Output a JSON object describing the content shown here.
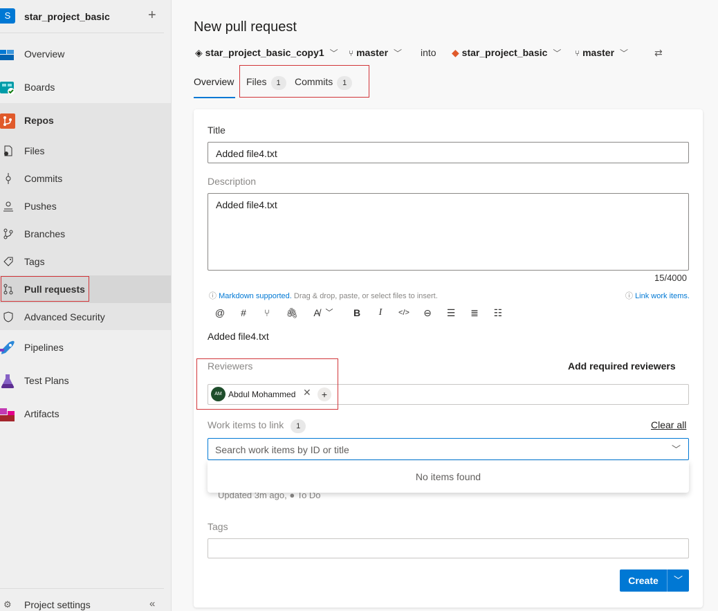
{
  "project": {
    "initial": "S",
    "name": "star_project_basic",
    "add_icon": "plus-icon"
  },
  "nav": {
    "overview": "Overview",
    "boards": "Boards",
    "repos": "Repos",
    "files": "Files",
    "commits": "Commits",
    "pushes": "Pushes",
    "branches": "Branches",
    "tags": "Tags",
    "pull_requests": "Pull requests",
    "advanced_security": "Advanced Security",
    "pipelines": "Pipelines",
    "test_plans": "Test Plans",
    "artifacts": "Artifacts",
    "project_settings": "Project settings",
    "collapse_glyph": "«"
  },
  "page": {
    "title": "New pull request"
  },
  "branches": {
    "source_repo": "star_project_basic_copy1",
    "source_branch": "master",
    "into": "into",
    "target_repo": "star_project_basic",
    "target_branch": "master",
    "swap_glyph": "⇄"
  },
  "tabs": [
    {
      "label": "Overview"
    },
    {
      "label": "Files",
      "count": "1"
    },
    {
      "label": "Commits",
      "count": "1"
    }
  ],
  "form": {
    "title_label": "Title",
    "title_value": "Added file4.txt",
    "description_label": "Description",
    "description_value": "Added file4.txt",
    "char_count": "15/4000",
    "markdown_link": "Markdown supported.",
    "markdown_hint": " Drag & drop, paste, or select files to insert.",
    "link_work_items": "Link work items.",
    "preview_text": "Added file4.txt",
    "reviewers_label": "Reviewers",
    "add_required_reviewers": "Add required reviewers",
    "reviewer": {
      "initials": "AM",
      "name": "Abdul Mohammed"
    },
    "work_items_label": "Work items to link",
    "work_items_count": "1",
    "clear_all": "Clear all",
    "search_placeholder": "Search work items by ID or title",
    "no_items": "No items found",
    "work_item_meta": "Updated 3m ago,  ●  To Do",
    "tags_label": "Tags",
    "create": "Create"
  },
  "toolbar_icons": [
    "at-icon",
    "hashtag-icon",
    "pull-request-icon",
    "attach-icon",
    "highlight-icon",
    "bold-icon",
    "italic-icon",
    "code-icon",
    "link-icon",
    "bullet-list-icon",
    "numbered-list-icon",
    "checklist-icon"
  ],
  "colors": {
    "accent": "#0078d4",
    "highlight_box": "#d13438",
    "avatar": "#1e4d2b"
  }
}
